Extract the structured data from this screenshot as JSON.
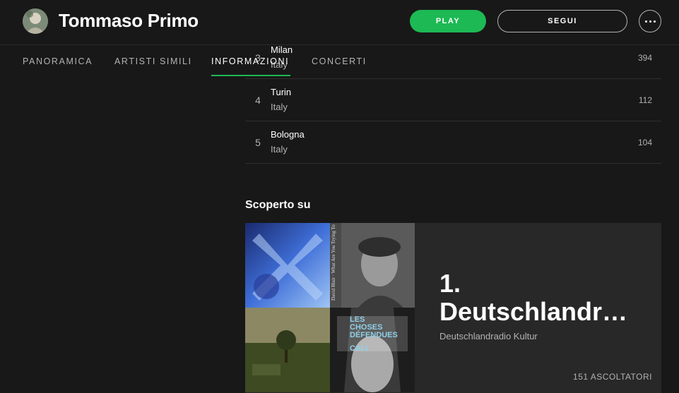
{
  "header": {
    "artist_name": "Tommaso Primo",
    "play_label": "PLAY",
    "follow_label": "SEGUI"
  },
  "tabs": [
    {
      "label": "PANORAMICA",
      "active": false
    },
    {
      "label": "ARTISTI SIMILI",
      "active": false
    },
    {
      "label": "INFORMAZIONI",
      "active": true
    },
    {
      "label": "CONCERTI",
      "active": false
    }
  ],
  "cities": [
    {
      "rank": "3",
      "city": "Milan",
      "country": "Italy",
      "listeners": "394"
    },
    {
      "rank": "4",
      "city": "Turin",
      "country": "Italy",
      "listeners": "112"
    },
    {
      "rank": "5",
      "city": "Bologna",
      "country": "Italy",
      "listeners": "104"
    }
  ],
  "discovered_on": {
    "section_title": "Scoperto su",
    "card": {
      "title": "1. Deutschlandr…",
      "subtitle": "Deutschlandradio Kultur",
      "listeners": "151 ASCOLTATORI"
    },
    "mosaic_text": {
      "tile2": "David Blair · What Are You Trying To Say",
      "tile4_line1": "LES",
      "tile4_line2": "CHOSES",
      "tile4_line3": "DÉFENDUES",
      "tile4_line4": "CALI"
    }
  },
  "colors": {
    "background": "#181818",
    "card": "#282828",
    "accent": "#1db954",
    "text_secondary": "#b3b3b3"
  },
  "icons": {
    "more": "ellipsis-icon"
  }
}
